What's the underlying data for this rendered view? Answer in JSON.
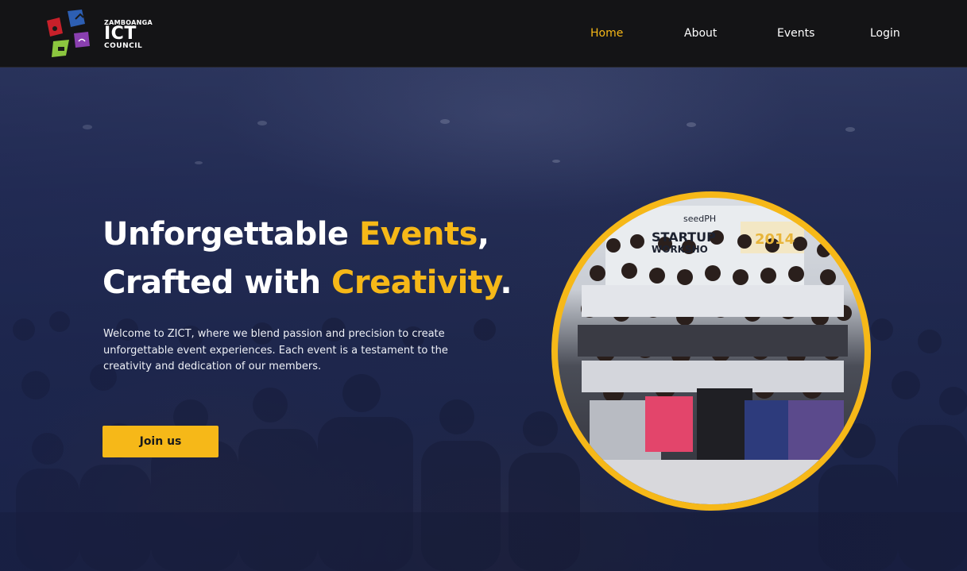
{
  "brand": {
    "top": "ZAMBOANGA",
    "main": "ICT",
    "bottom": "COUNCIL"
  },
  "nav": {
    "items": [
      "Home",
      "About",
      "Events",
      "Login"
    ],
    "active": "Home"
  },
  "hero": {
    "headline_part1": "Unforgettable ",
    "headline_accent1": "Events",
    "headline_part2": ",",
    "headline_part3": "Crafted with ",
    "headline_accent2": "Creativity",
    "headline_part4": ".",
    "description": "Welcome to ZICT, where we blend passion and precision to create unforgettable event experiences. Each event is a testament to the creativity and dedication of our members.",
    "cta_label": "Join us"
  },
  "photo": {
    "banner_brand": "seedPH",
    "banner_title": "STARTUP",
    "banner_sub": "WORKSHO",
    "banner_year": "2014"
  },
  "colors": {
    "accent": "#f6b818",
    "header_bg": "#141416",
    "hero_tint": "#26305a"
  }
}
